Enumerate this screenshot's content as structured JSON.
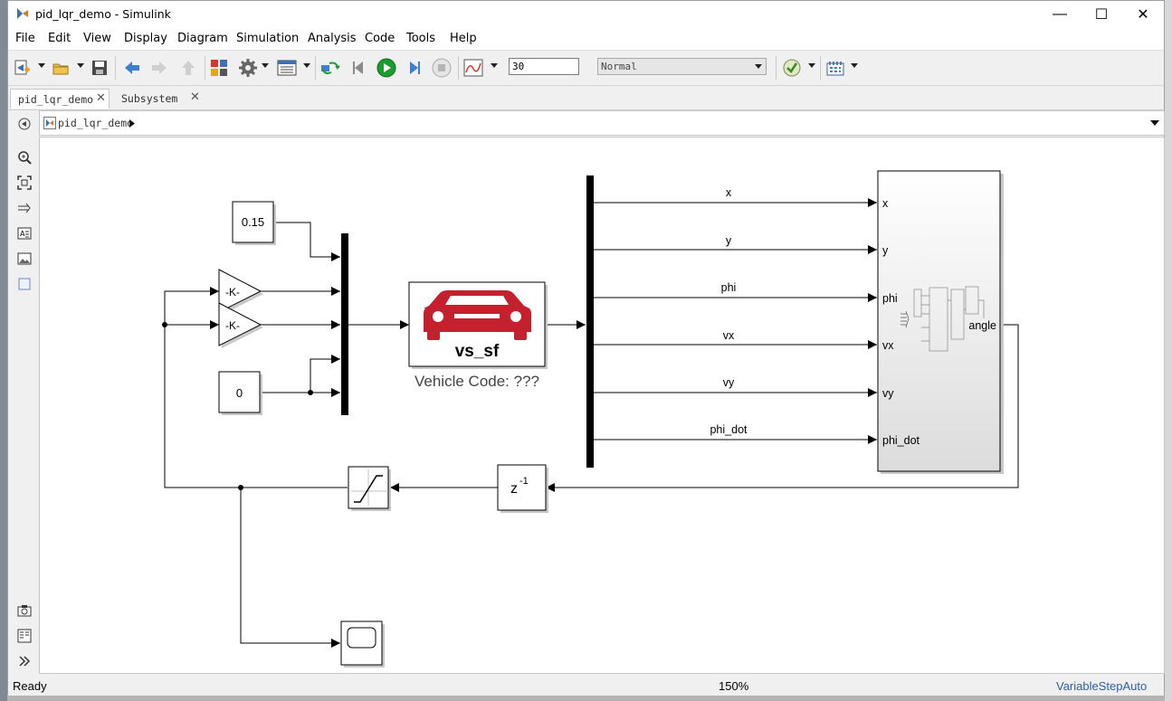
{
  "window": {
    "title": "pid_lqr_demo - Simulink",
    "minimize": "—",
    "maximize": "☐",
    "close": "✕"
  },
  "menu": [
    "File",
    "Edit",
    "View",
    "Display",
    "Diagram",
    "Simulation",
    "Analysis",
    "Code",
    "Tools",
    "Help"
  ],
  "toolbar": {
    "stop_time": "30",
    "sim_mode": "Normal"
  },
  "tabs": [
    {
      "label": "pid_lqr_demo",
      "close": "✕"
    },
    {
      "label": "Subsystem",
      "close": "✕"
    }
  ],
  "breadcrumb": {
    "model": "pid_lqr_demo"
  },
  "diagram": {
    "const1": "0.15",
    "const2": "0",
    "gain1": "-K-",
    "gain2": "-K-",
    "vehicle_text": "vs_sf",
    "vehicle_caption": "Vehicle Code: ???",
    "delay_label": "z",
    "delay_exp": "-1",
    "signals": [
      "x",
      "y",
      "phi",
      "vx",
      "vy",
      "phi_dot"
    ],
    "ports_in": [
      "x",
      "y",
      "phi",
      "vx",
      "vy",
      "phi_dot"
    ],
    "port_out": "angle"
  },
  "status": {
    "state": "Ready",
    "zoom": "150%",
    "solver": "VariableStepAuto"
  },
  "colors": {
    "car": "#c4202e",
    "run": "#1a9c2e",
    "nav_arrow": "#3d7fcf"
  }
}
